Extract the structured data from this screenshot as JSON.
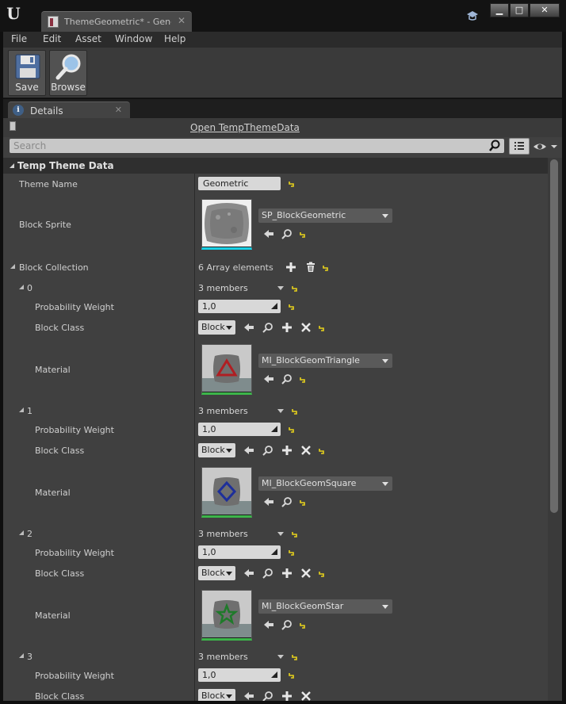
{
  "window": {
    "tab_title": "ThemeGeometric* - Generi",
    "minimize": "▁",
    "maximize": "□",
    "close": "✕"
  },
  "menu": [
    "File",
    "Edit",
    "Asset",
    "Window",
    "Help"
  ],
  "toolbar": {
    "save_label": "Save",
    "browse_label": "Browse"
  },
  "details_tab": {
    "label": "Details"
  },
  "open_link": "Open TempThemeData",
  "search": {
    "placeholder": "Search"
  },
  "section": {
    "title": "Temp Theme Data"
  },
  "theme_name": {
    "label": "Theme Name",
    "value": "Geometric"
  },
  "block_sprite": {
    "label": "Block Sprite",
    "asset": "SP_BlockGeometric"
  },
  "block_collection": {
    "label": "Block Collection",
    "summary": "6 Array elements"
  },
  "elements": [
    {
      "index": "0",
      "members": "3 members",
      "prob_label": "Probability Weight",
      "prob_value": "1,0",
      "class_label": "Block Class",
      "class_value": "Block",
      "material_label": "Material",
      "material_asset": "MI_BlockGeomTriangle",
      "shape": "triangle",
      "shape_color": "#b01e22"
    },
    {
      "index": "1",
      "members": "3 members",
      "prob_label": "Probability Weight",
      "prob_value": "1,0",
      "class_label": "Block Class",
      "class_value": "Block",
      "material_label": "Material",
      "material_asset": "MI_BlockGeomSquare",
      "shape": "diamond",
      "shape_color": "#1e2f9a"
    },
    {
      "index": "2",
      "members": "3 members",
      "prob_label": "Probability Weight",
      "prob_value": "1,0",
      "class_label": "Block Class",
      "class_value": "Block",
      "material_label": "Material",
      "material_asset": "MI_BlockGeomStar",
      "shape": "star",
      "shape_color": "#1f7a2a"
    },
    {
      "index": "3",
      "members": "3 members",
      "prob_label": "Probability Weight",
      "prob_value": "1,0",
      "class_label": "Block Class",
      "class_value": "Block"
    }
  ],
  "colors": {
    "panel_bg": "#404040",
    "header_bg": "#2f2f2f",
    "field_bg": "#d8d8d8",
    "reset_yellow": "#e8d21c"
  }
}
